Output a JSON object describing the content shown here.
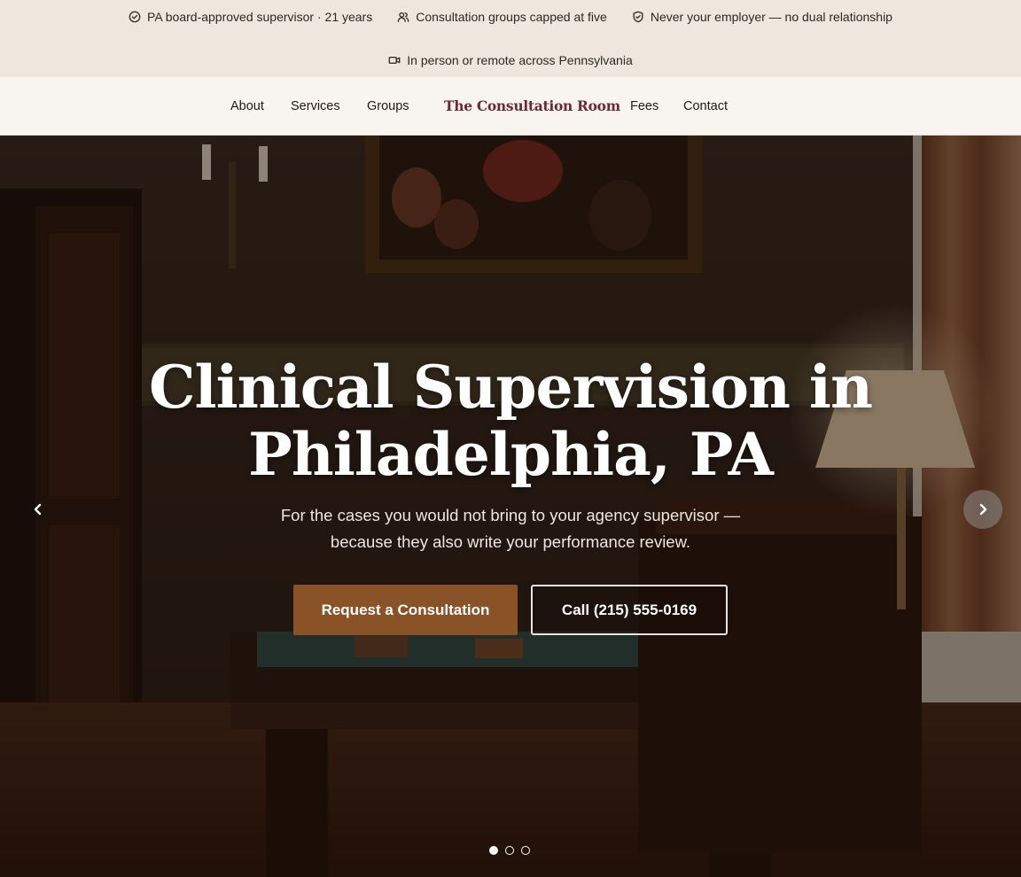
{
  "trust_bar": {
    "items": [
      {
        "icon": "check-circle-icon",
        "text": "PA board-approved supervisor · 21 years"
      },
      {
        "icon": "users-icon",
        "text": "Consultation groups capped at five"
      },
      {
        "icon": "shield-check-icon",
        "text": "Never your employer — no dual relationship"
      },
      {
        "icon": "video-icon",
        "text": "In person or remote across Pennsylvania"
      }
    ]
  },
  "nav": {
    "links": [
      "About",
      "Services",
      "Groups",
      "Fees",
      "Contact"
    ],
    "brand": "The Consultation Room"
  },
  "hero": {
    "title_line1": "Clinical Supervision in",
    "title_line2": "Philadelphia, PA",
    "subtitle_line1": "For the cases you would not bring to your agency supervisor —",
    "subtitle_line2": "because they also write your performance review.",
    "primary_cta": "Request a Consultation",
    "secondary_cta": "Call (215) 555-0169",
    "slide_count": 3,
    "active_slide": 1
  },
  "colors": {
    "accent": "#8a5227",
    "brand": "#6b2a33",
    "topbar_bg": "#efe7dd",
    "nav_bg": "#f8f4ef"
  }
}
